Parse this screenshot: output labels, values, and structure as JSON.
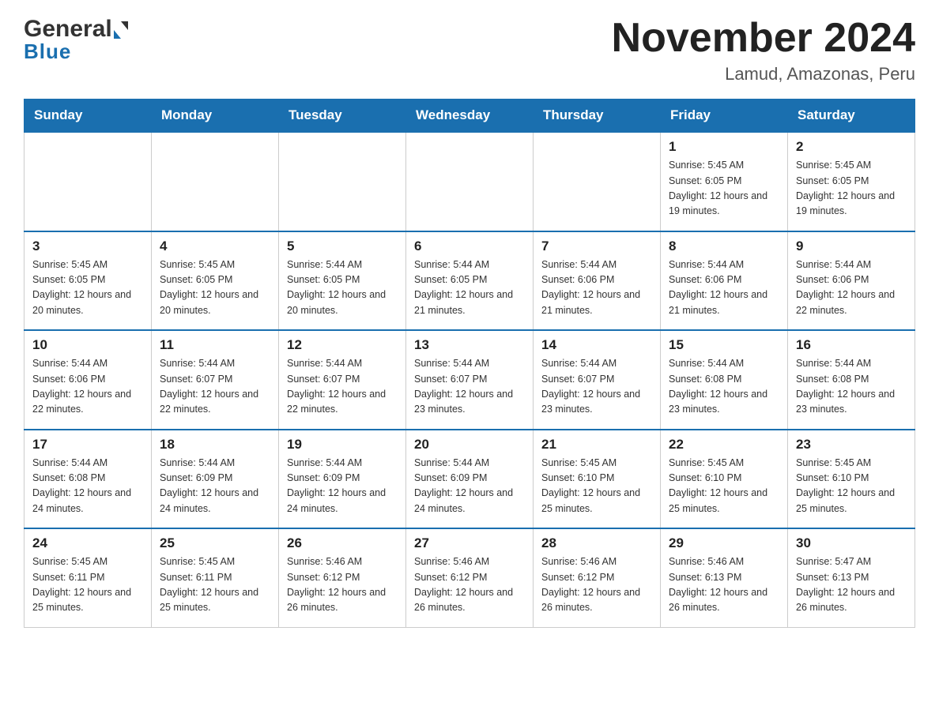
{
  "logo": {
    "text1": "General",
    "text2": "Blue"
  },
  "header": {
    "title": "November 2024",
    "subtitle": "Lamud, Amazonas, Peru"
  },
  "weekdays": [
    "Sunday",
    "Monday",
    "Tuesday",
    "Wednesday",
    "Thursday",
    "Friday",
    "Saturday"
  ],
  "weeks": [
    [
      {
        "day": "",
        "sunrise": "",
        "sunset": "",
        "daylight": ""
      },
      {
        "day": "",
        "sunrise": "",
        "sunset": "",
        "daylight": ""
      },
      {
        "day": "",
        "sunrise": "",
        "sunset": "",
        "daylight": ""
      },
      {
        "day": "",
        "sunrise": "",
        "sunset": "",
        "daylight": ""
      },
      {
        "day": "",
        "sunrise": "",
        "sunset": "",
        "daylight": ""
      },
      {
        "day": "1",
        "sunrise": "Sunrise: 5:45 AM",
        "sunset": "Sunset: 6:05 PM",
        "daylight": "Daylight: 12 hours and 19 minutes."
      },
      {
        "day": "2",
        "sunrise": "Sunrise: 5:45 AM",
        "sunset": "Sunset: 6:05 PM",
        "daylight": "Daylight: 12 hours and 19 minutes."
      }
    ],
    [
      {
        "day": "3",
        "sunrise": "Sunrise: 5:45 AM",
        "sunset": "Sunset: 6:05 PM",
        "daylight": "Daylight: 12 hours and 20 minutes."
      },
      {
        "day": "4",
        "sunrise": "Sunrise: 5:45 AM",
        "sunset": "Sunset: 6:05 PM",
        "daylight": "Daylight: 12 hours and 20 minutes."
      },
      {
        "day": "5",
        "sunrise": "Sunrise: 5:44 AM",
        "sunset": "Sunset: 6:05 PM",
        "daylight": "Daylight: 12 hours and 20 minutes."
      },
      {
        "day": "6",
        "sunrise": "Sunrise: 5:44 AM",
        "sunset": "Sunset: 6:05 PM",
        "daylight": "Daylight: 12 hours and 21 minutes."
      },
      {
        "day": "7",
        "sunrise": "Sunrise: 5:44 AM",
        "sunset": "Sunset: 6:06 PM",
        "daylight": "Daylight: 12 hours and 21 minutes."
      },
      {
        "day": "8",
        "sunrise": "Sunrise: 5:44 AM",
        "sunset": "Sunset: 6:06 PM",
        "daylight": "Daylight: 12 hours and 21 minutes."
      },
      {
        "day": "9",
        "sunrise": "Sunrise: 5:44 AM",
        "sunset": "Sunset: 6:06 PM",
        "daylight": "Daylight: 12 hours and 22 minutes."
      }
    ],
    [
      {
        "day": "10",
        "sunrise": "Sunrise: 5:44 AM",
        "sunset": "Sunset: 6:06 PM",
        "daylight": "Daylight: 12 hours and 22 minutes."
      },
      {
        "day": "11",
        "sunrise": "Sunrise: 5:44 AM",
        "sunset": "Sunset: 6:07 PM",
        "daylight": "Daylight: 12 hours and 22 minutes."
      },
      {
        "day": "12",
        "sunrise": "Sunrise: 5:44 AM",
        "sunset": "Sunset: 6:07 PM",
        "daylight": "Daylight: 12 hours and 22 minutes."
      },
      {
        "day": "13",
        "sunrise": "Sunrise: 5:44 AM",
        "sunset": "Sunset: 6:07 PM",
        "daylight": "Daylight: 12 hours and 23 minutes."
      },
      {
        "day": "14",
        "sunrise": "Sunrise: 5:44 AM",
        "sunset": "Sunset: 6:07 PM",
        "daylight": "Daylight: 12 hours and 23 minutes."
      },
      {
        "day": "15",
        "sunrise": "Sunrise: 5:44 AM",
        "sunset": "Sunset: 6:08 PM",
        "daylight": "Daylight: 12 hours and 23 minutes."
      },
      {
        "day": "16",
        "sunrise": "Sunrise: 5:44 AM",
        "sunset": "Sunset: 6:08 PM",
        "daylight": "Daylight: 12 hours and 23 minutes."
      }
    ],
    [
      {
        "day": "17",
        "sunrise": "Sunrise: 5:44 AM",
        "sunset": "Sunset: 6:08 PM",
        "daylight": "Daylight: 12 hours and 24 minutes."
      },
      {
        "day": "18",
        "sunrise": "Sunrise: 5:44 AM",
        "sunset": "Sunset: 6:09 PM",
        "daylight": "Daylight: 12 hours and 24 minutes."
      },
      {
        "day": "19",
        "sunrise": "Sunrise: 5:44 AM",
        "sunset": "Sunset: 6:09 PM",
        "daylight": "Daylight: 12 hours and 24 minutes."
      },
      {
        "day": "20",
        "sunrise": "Sunrise: 5:44 AM",
        "sunset": "Sunset: 6:09 PM",
        "daylight": "Daylight: 12 hours and 24 minutes."
      },
      {
        "day": "21",
        "sunrise": "Sunrise: 5:45 AM",
        "sunset": "Sunset: 6:10 PM",
        "daylight": "Daylight: 12 hours and 25 minutes."
      },
      {
        "day": "22",
        "sunrise": "Sunrise: 5:45 AM",
        "sunset": "Sunset: 6:10 PM",
        "daylight": "Daylight: 12 hours and 25 minutes."
      },
      {
        "day": "23",
        "sunrise": "Sunrise: 5:45 AM",
        "sunset": "Sunset: 6:10 PM",
        "daylight": "Daylight: 12 hours and 25 minutes."
      }
    ],
    [
      {
        "day": "24",
        "sunrise": "Sunrise: 5:45 AM",
        "sunset": "Sunset: 6:11 PM",
        "daylight": "Daylight: 12 hours and 25 minutes."
      },
      {
        "day": "25",
        "sunrise": "Sunrise: 5:45 AM",
        "sunset": "Sunset: 6:11 PM",
        "daylight": "Daylight: 12 hours and 25 minutes."
      },
      {
        "day": "26",
        "sunrise": "Sunrise: 5:46 AM",
        "sunset": "Sunset: 6:12 PM",
        "daylight": "Daylight: 12 hours and 26 minutes."
      },
      {
        "day": "27",
        "sunrise": "Sunrise: 5:46 AM",
        "sunset": "Sunset: 6:12 PM",
        "daylight": "Daylight: 12 hours and 26 minutes."
      },
      {
        "day": "28",
        "sunrise": "Sunrise: 5:46 AM",
        "sunset": "Sunset: 6:12 PM",
        "daylight": "Daylight: 12 hours and 26 minutes."
      },
      {
        "day": "29",
        "sunrise": "Sunrise: 5:46 AM",
        "sunset": "Sunset: 6:13 PM",
        "daylight": "Daylight: 12 hours and 26 minutes."
      },
      {
        "day": "30",
        "sunrise": "Sunrise: 5:47 AM",
        "sunset": "Sunset: 6:13 PM",
        "daylight": "Daylight: 12 hours and 26 minutes."
      }
    ]
  ]
}
